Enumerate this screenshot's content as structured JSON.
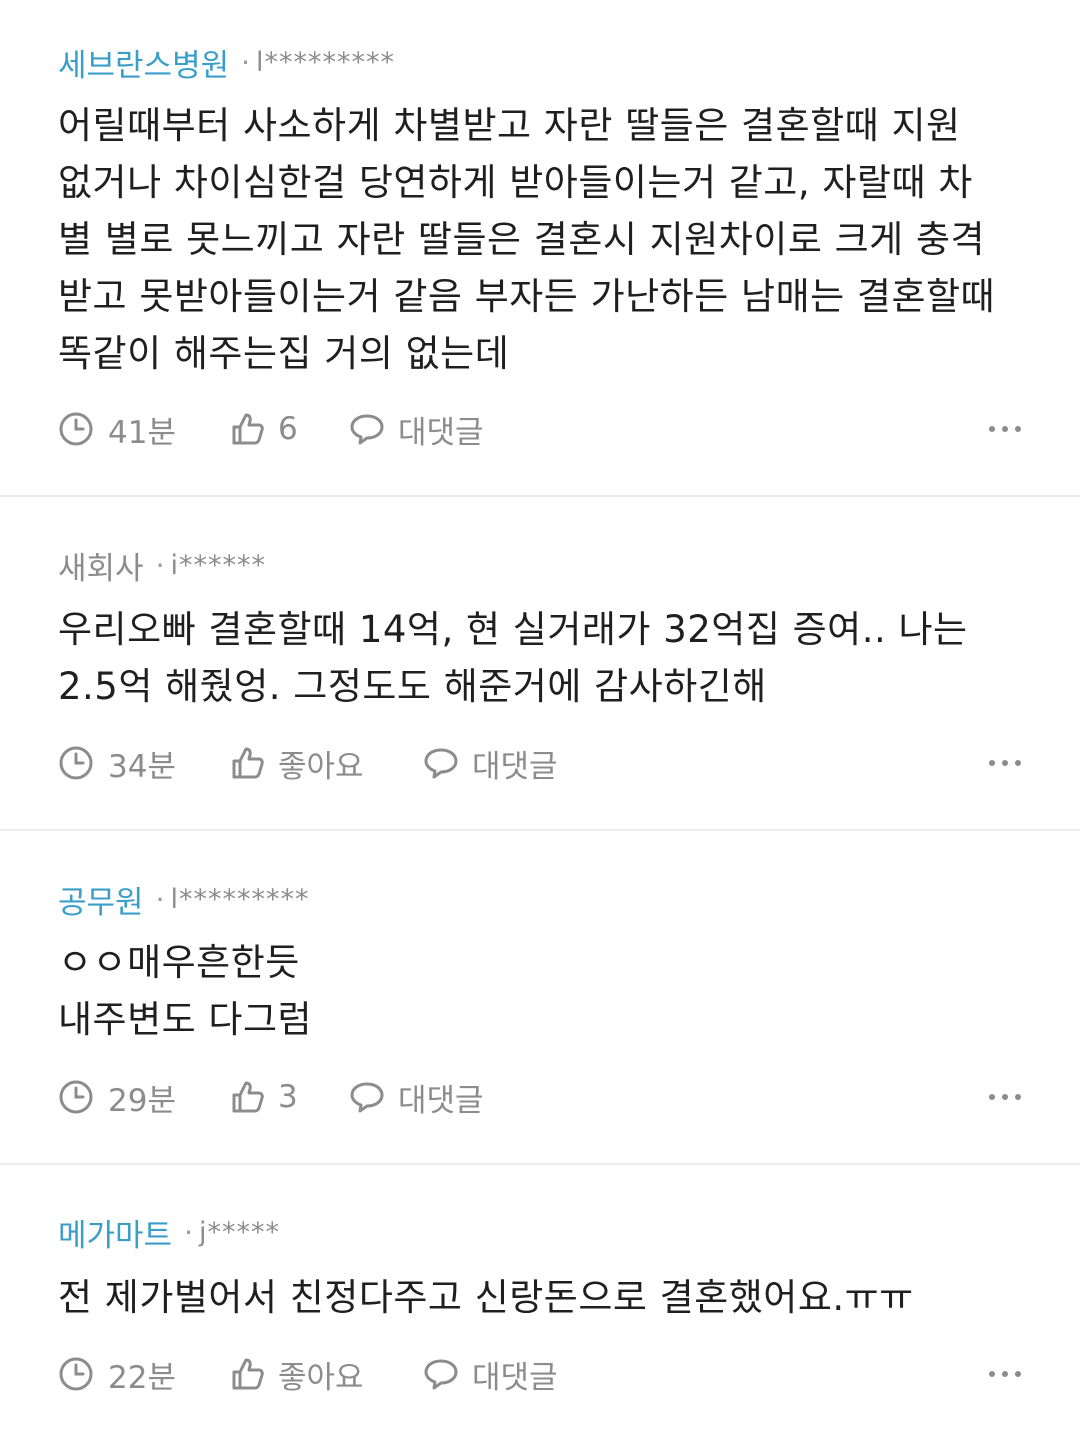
{
  "comments": [
    {
      "company": "세브란스병원",
      "separator": "·",
      "user_id": "l*********",
      "text": "어릴때부터 사소하게 차별받고 자란 딸들은 결혼할때 지원\n없거나 차이심한걸 당연하게 받아들이는거 같고, 자랄때 차\n별 별로 못느끼고 자란 딸들은 결혼시 지원차이로 크게 충격\n받고 못받아들이는거 같음 부자든 가난하든 남매는 결혼할때\n똑같이 해주는집 거의 없는데",
      "time": "41분",
      "likes": "6",
      "reply_label": "대댓글"
    },
    {
      "company": "새회사",
      "separator": "·",
      "user_id": "i******",
      "text": "우리오빠 결혼할때 14억, 현 실거래가 32억집 증여.. 나는\n2.5억 해줬엉. 그정도도 해준거에 감사하긴해",
      "time": "34분",
      "likes": "좋아요",
      "reply_label": "대댓글"
    },
    {
      "company": "공무원",
      "separator": "·",
      "user_id": "l*********",
      "text": "ㅇㅇ매우흔한듯\n내주변도 다그럼",
      "time": "29분",
      "likes": "3",
      "reply_label": "대댓글"
    },
    {
      "company": "메가마트",
      "separator": "·",
      "user_id": "j*****",
      "text": "전 제가벌어서 친정다주고 신랑돈으로 결혼했어요.ㅠㅠ",
      "time": "22분",
      "likes": "좋아요",
      "reply_label": "대댓글"
    }
  ],
  "colors": {
    "company_verified": "#3a9fc8",
    "company_plain": "#8c8c8c",
    "meta_text": "#8c8c8c",
    "body_text": "#1f1f1f",
    "divider": "#ededed"
  },
  "icons": {
    "time": "clock-icon",
    "like": "thumbs-up-icon",
    "reply": "speech-bubble-icon",
    "more": "more-dots-icon"
  }
}
